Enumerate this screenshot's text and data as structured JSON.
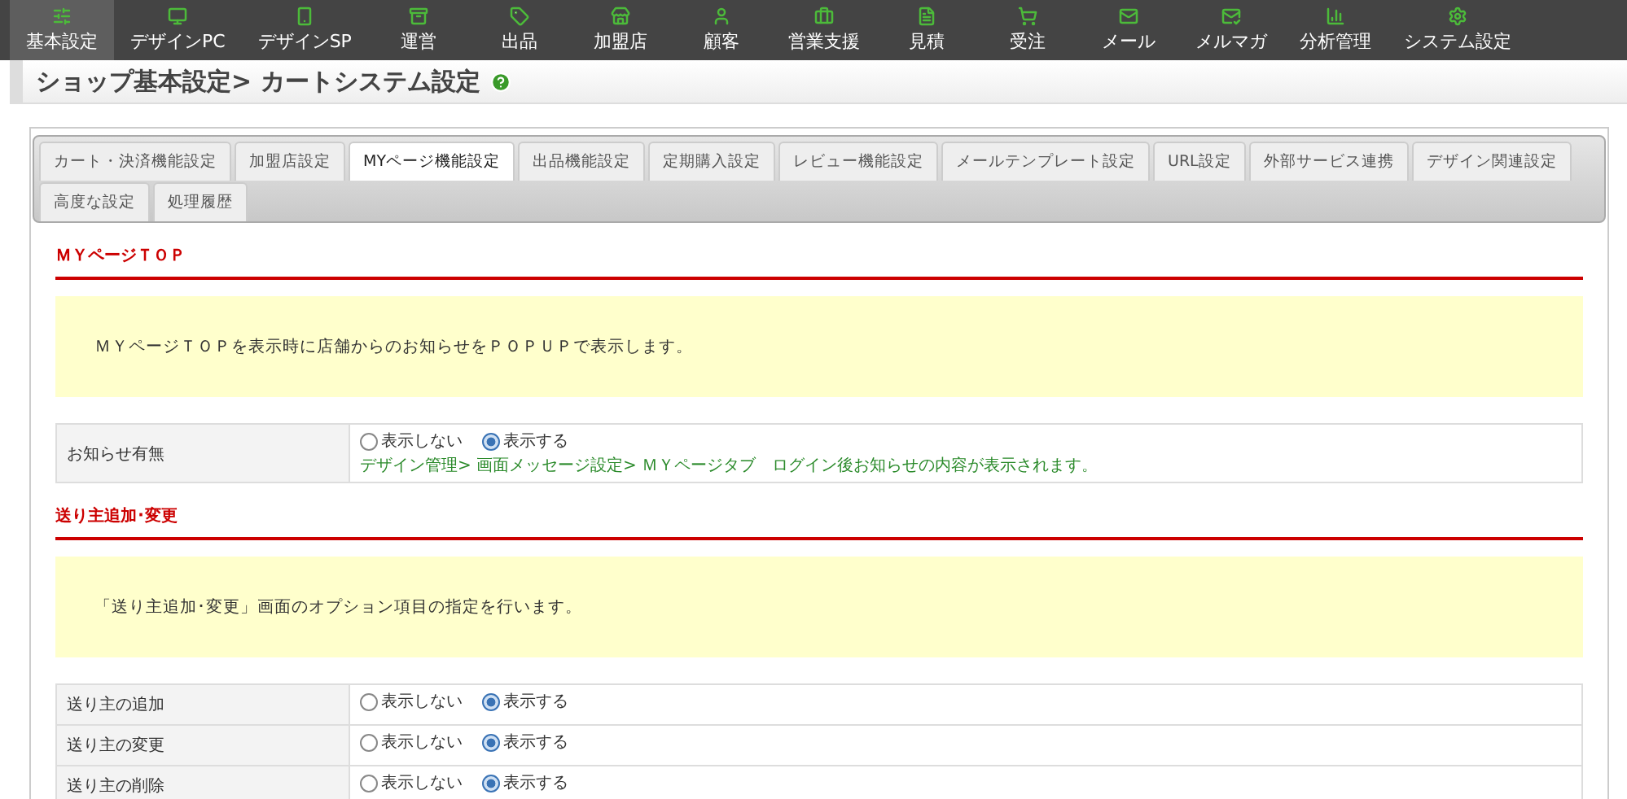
{
  "nav": [
    {
      "label": "基本設定",
      "selected": true
    },
    {
      "label": "デザインPC",
      "selected": false
    },
    {
      "label": "デザインSP",
      "selected": false
    },
    {
      "label": "運営",
      "selected": false
    },
    {
      "label": "出品",
      "selected": false
    },
    {
      "label": "加盟店",
      "selected": false
    },
    {
      "label": "顧客",
      "selected": false
    },
    {
      "label": "営業支援",
      "selected": false
    },
    {
      "label": "見積",
      "selected": false
    },
    {
      "label": "受注",
      "selected": false
    },
    {
      "label": "メール",
      "selected": false
    },
    {
      "label": "メルマガ",
      "selected": false
    },
    {
      "label": "分析管理",
      "selected": false
    },
    {
      "label": "システム設定",
      "selected": false
    }
  ],
  "page_title": "ショップ基本設定> カートシステム設定",
  "tabs": [
    {
      "label": "カート・決済機能設定",
      "selected": false
    },
    {
      "label": "加盟店設定",
      "selected": false
    },
    {
      "label": "MYページ機能設定",
      "selected": true
    },
    {
      "label": "出品機能設定",
      "selected": false
    },
    {
      "label": "定期購入設定",
      "selected": false
    },
    {
      "label": "レビュー機能設定",
      "selected": false
    },
    {
      "label": "メールテンプレート設定",
      "selected": false
    },
    {
      "label": "URL設定",
      "selected": false
    },
    {
      "label": "外部サービス連携",
      "selected": false
    },
    {
      "label": "デザイン関連設定",
      "selected": false
    },
    {
      "label": "高度な設定",
      "selected": false
    },
    {
      "label": "処理履歴",
      "selected": false
    }
  ],
  "sections": [
    {
      "heading": "ＭＹページＴＯＰ",
      "notice": "ＭＹページＴＯＰを表示時に店舗からのお知らせをＰＯＰＵＰで表示します。",
      "rows": [
        {
          "label": "お知らせ有無",
          "options": [
            {
              "label": "表示しない",
              "selected": false
            },
            {
              "label": "表示する",
              "selected": true
            }
          ],
          "note": "デザイン管理> 画面メッセージ設定> ＭＹページタブ　ログイン後お知らせの内容が表示されます。"
        }
      ]
    },
    {
      "heading": "送り主追加･変更",
      "notice": "「送り主追加･変更」画面のオプション項目の指定を行います。",
      "rows": [
        {
          "label": "送り主の追加",
          "options": [
            {
              "label": "表示しない",
              "selected": false
            },
            {
              "label": "表示する",
              "selected": true
            }
          ]
        },
        {
          "label": "送り主の変更",
          "options": [
            {
              "label": "表示しない",
              "selected": false
            },
            {
              "label": "表示する",
              "selected": true
            }
          ]
        },
        {
          "label": "送り主の削除",
          "options": [
            {
              "label": "表示しない",
              "selected": false
            },
            {
              "label": "表示する",
              "selected": true
            }
          ]
        }
      ]
    }
  ]
}
